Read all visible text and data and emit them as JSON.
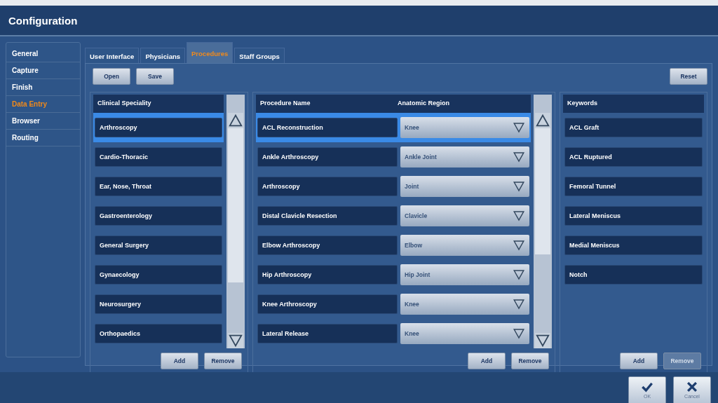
{
  "window": {
    "title": "Configuration"
  },
  "sidebar": {
    "items": [
      {
        "label": "General",
        "selected": false
      },
      {
        "label": "Capture",
        "selected": false
      },
      {
        "label": "Finish",
        "selected": false
      },
      {
        "label": "Data Entry",
        "selected": true
      },
      {
        "label": "Browser",
        "selected": false
      },
      {
        "label": "Routing",
        "selected": false
      }
    ]
  },
  "tabs": [
    {
      "label": "User Interface",
      "selected": false
    },
    {
      "label": "Physicians",
      "selected": false
    },
    {
      "label": "Procedures",
      "selected": true
    },
    {
      "label": "Staff Groups",
      "selected": false
    }
  ],
  "toolbar": {
    "open": "Open",
    "save": "Save",
    "reset": "Reset"
  },
  "specialities": {
    "heading": "Clinical Speciality",
    "items": [
      {
        "label": "Arthroscopy",
        "selected": true
      },
      {
        "label": "Cardio-Thoracic",
        "selected": false
      },
      {
        "label": "Ear, Nose, Throat",
        "selected": false
      },
      {
        "label": "Gastroenterology",
        "selected": false
      },
      {
        "label": "General Surgery",
        "selected": false
      },
      {
        "label": "Gynaecology",
        "selected": false
      },
      {
        "label": "Neurosurgery",
        "selected": false
      },
      {
        "label": "Orthopaedics",
        "selected": false
      }
    ],
    "add": {
      "label": "Add",
      "disabled": false
    },
    "remove": {
      "label": "Remove",
      "disabled": false
    }
  },
  "procedures": {
    "heading_name": "Procedure Name",
    "heading_region": "Anatomic Region",
    "items": [
      {
        "name": "ACL Reconstruction",
        "region": "Knee",
        "selected": true
      },
      {
        "name": "Ankle Arthroscopy",
        "region": "Ankle Joint",
        "selected": false
      },
      {
        "name": "Arthroscopy",
        "region": "Joint",
        "selected": false
      },
      {
        "name": "Distal Clavicle Resection",
        "region": "Clavicle",
        "selected": false
      },
      {
        "name": "Elbow Arthroscopy",
        "region": "Elbow",
        "selected": false
      },
      {
        "name": "Hip Arthroscopy",
        "region": "Hip Joint",
        "selected": false
      },
      {
        "name": "Knee Arthroscopy",
        "region": "Knee",
        "selected": false
      },
      {
        "name": "Lateral Release",
        "region": "Knee",
        "selected": false
      }
    ],
    "add": {
      "label": "Add",
      "disabled": false
    },
    "remove": {
      "label": "Remove",
      "disabled": false
    }
  },
  "keywords": {
    "heading": "Keywords",
    "items": [
      {
        "label": "ACL Graft"
      },
      {
        "label": "ACL Ruptured"
      },
      {
        "label": "Femoral Tunnel"
      },
      {
        "label": "Lateral Meniscus"
      },
      {
        "label": "Medial Meniscus"
      },
      {
        "label": "Notch"
      }
    ],
    "add": {
      "label": "Add",
      "disabled": false
    },
    "remove": {
      "label": "Remove",
      "disabled": true
    }
  },
  "footer": {
    "ok": "OK",
    "cancel": "Cancel"
  }
}
